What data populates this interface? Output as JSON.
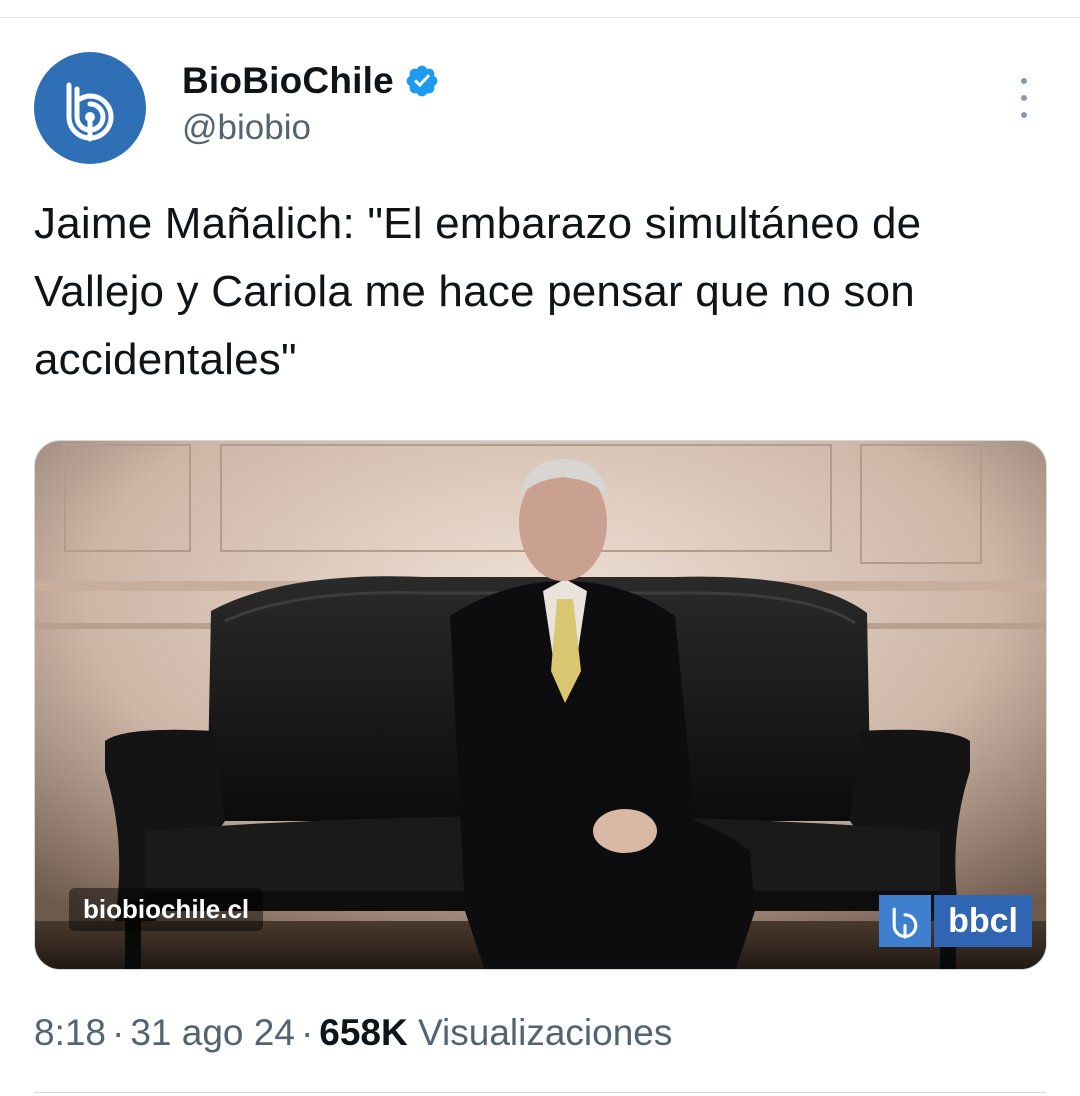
{
  "account": {
    "display_name": "BioBioChile",
    "handle": "@biobio",
    "verified_icon": "verified-badge-icon",
    "avatar_icon": "biobio-logo-icon",
    "brand_color": "#2e6fb5"
  },
  "tweet": {
    "text": "Jaime Mañalich: \"El embarazo simultáneo de Vallejo y Cariola me hace pensar que no son accidentales\""
  },
  "media": {
    "watermark_url": "biobiochile.cl",
    "watermark_logo_text": "bbcl"
  },
  "meta": {
    "time": "8:18",
    "date": "31 ago 24",
    "separator": "·",
    "views_count": "658K",
    "views_label": "Visualizaciones"
  },
  "colors": {
    "text_primary": "#0f1419",
    "text_secondary": "#536471",
    "verified_blue": "#1d9bf0"
  }
}
